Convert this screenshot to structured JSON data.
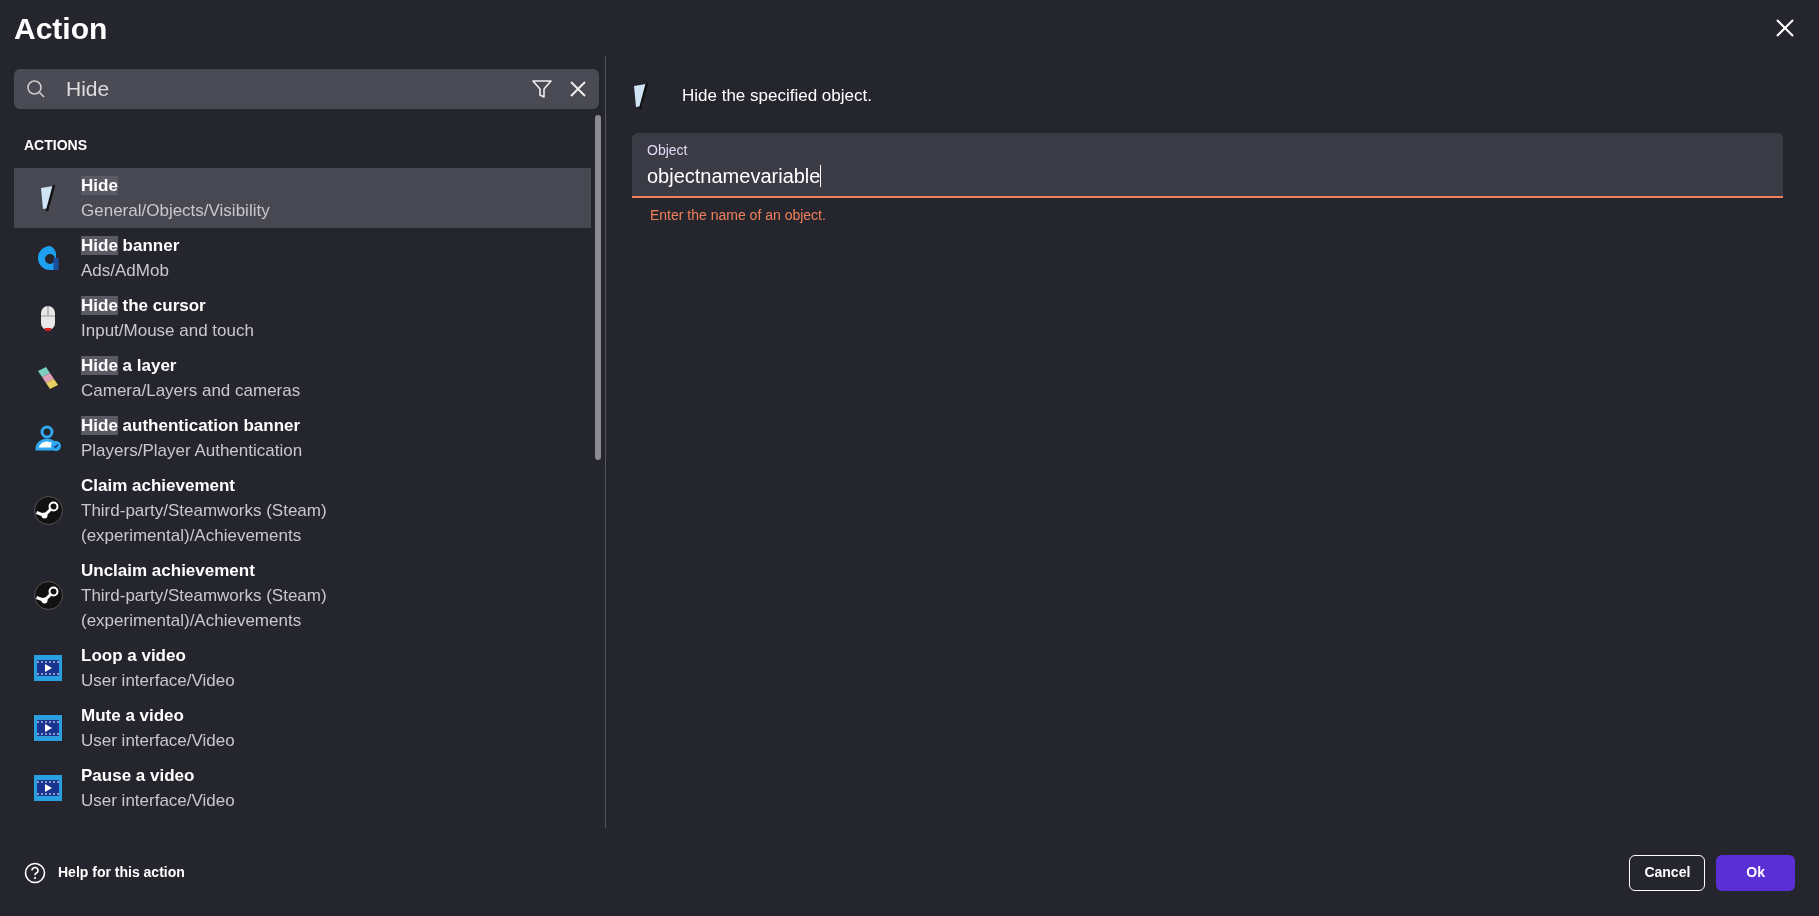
{
  "dialog": {
    "title": "Action"
  },
  "search": {
    "value": "Hide"
  },
  "section_label": "ACTIONS",
  "actions": [
    {
      "kind": "eraser",
      "title": [
        {
          "text": "Hide",
          "highlighted": true
        }
      ],
      "path": "General/Objects/Visibility",
      "selected": true
    },
    {
      "kind": "ring",
      "title": [
        {
          "text": "Hide",
          "highlighted": true
        },
        {
          "text": "banner",
          "highlighted": false
        }
      ],
      "path": "Ads/AdMob",
      "selected": false
    },
    {
      "kind": "mouse",
      "title": [
        {
          "text": "Hide",
          "highlighted": true
        },
        {
          "text": "the cursor",
          "highlighted": false
        }
      ],
      "path": "Input/Mouse and touch",
      "selected": false
    },
    {
      "kind": "layers",
      "title": [
        {
          "text": "Hide",
          "highlighted": true
        },
        {
          "text": "a layer",
          "highlighted": false
        }
      ],
      "path": "Camera/Layers and cameras",
      "selected": false
    },
    {
      "kind": "user",
      "title": [
        {
          "text": "Hide",
          "highlighted": true
        },
        {
          "text": "authentication banner",
          "highlighted": false
        }
      ],
      "path": "Players/Player Authentication",
      "selected": false
    },
    {
      "kind": "steam",
      "title": [
        {
          "text": "Claim achievement",
          "highlighted": false
        }
      ],
      "path": "Third-party/Steamworks (Steam) (experimental)/Achievements",
      "selected": false
    },
    {
      "kind": "steam",
      "title": [
        {
          "text": "Unclaim achievement",
          "highlighted": false
        }
      ],
      "path": "Third-party/Steamworks (Steam) (experimental)/Achievements",
      "selected": false
    },
    {
      "kind": "video",
      "title": [
        {
          "text": "Loop a video",
          "highlighted": false
        }
      ],
      "path": "User interface/Video",
      "selected": false
    },
    {
      "kind": "video",
      "title": [
        {
          "text": "Mute a video",
          "highlighted": false
        }
      ],
      "path": "User interface/Video",
      "selected": false
    },
    {
      "kind": "video",
      "title": [
        {
          "text": "Pause a video",
          "highlighted": false
        }
      ],
      "path": "User interface/Video",
      "selected": false
    }
  ],
  "description": "Hide the specified object.",
  "object_field": {
    "label": "Object",
    "value": "objectnamevariable",
    "error": "Enter the name of an object."
  },
  "help_link": "Help for this action",
  "buttons": [
    {
      "kind": "secondary",
      "label": "Cancel"
    },
    {
      "kind": "primary",
      "label": "Ok"
    }
  ]
}
